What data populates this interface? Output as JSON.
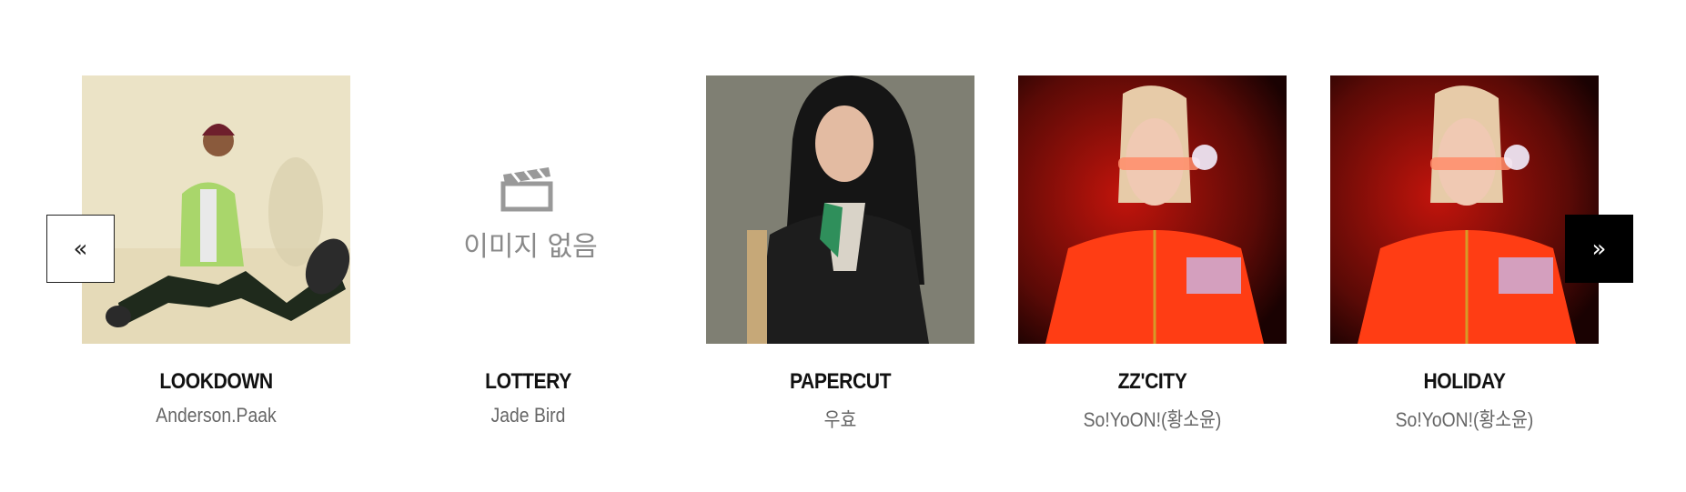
{
  "carousel": {
    "prev_icon": "«",
    "next_icon": "»",
    "placeholder_text": "이미지 없음",
    "items": [
      {
        "title": "LOOKDOWN",
        "artist": "Anderson.Paak"
      },
      {
        "title": "LOTTERY",
        "artist": "Jade Bird"
      },
      {
        "title": "PAPERCUT",
        "artist": "우효"
      },
      {
        "title": "ZZ'CITY",
        "artist": "So!YoON!(황소윤)"
      },
      {
        "title": "HOLIDAY",
        "artist": "So!YoON!(황소윤)"
      }
    ]
  },
  "colors": {
    "title": "#111111",
    "artist": "#666666",
    "next_button_bg": "#000000",
    "prev_button_bg": "#ffffff"
  }
}
